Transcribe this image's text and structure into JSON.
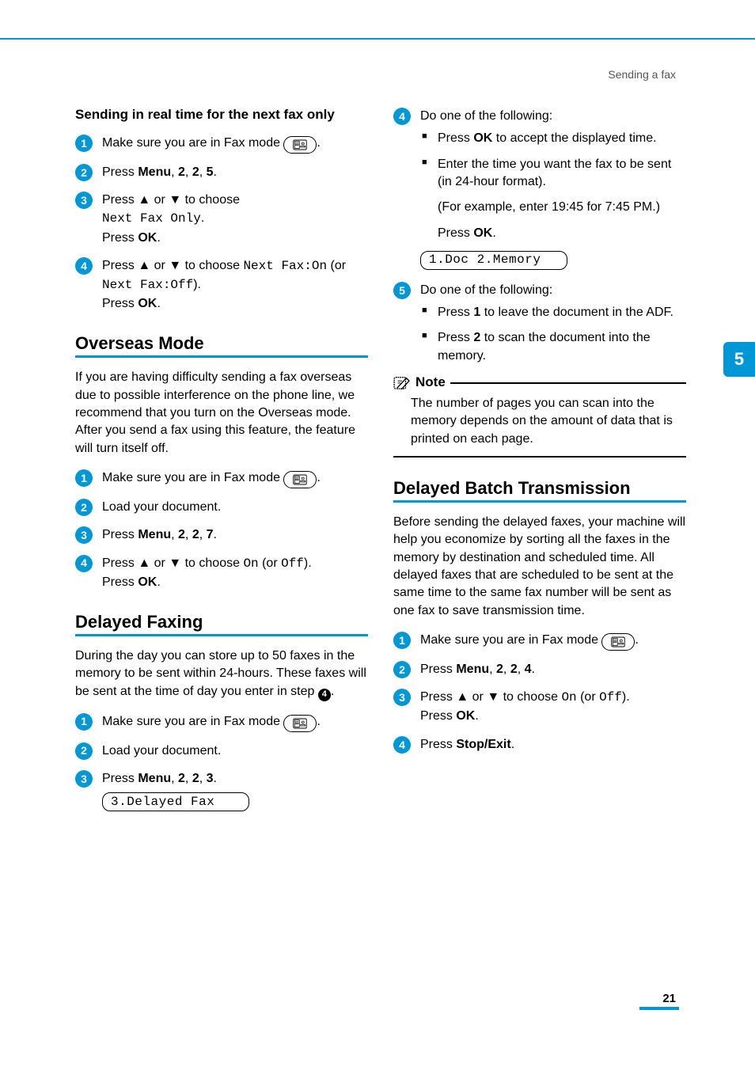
{
  "header": {
    "breadcrumb": "Sending a fax"
  },
  "tab": {
    "label": "5"
  },
  "footer": {
    "page": "21"
  },
  "left": {
    "realtime": {
      "title": "Sending in real time for the next fax only",
      "s1_a": "Make sure you are in Fax mode ",
      "s1_b": ".",
      "s2_a": "Press ",
      "s2_menu": "Menu",
      "s2_b": ", ",
      "s2_n1": "2",
      "s2_c": ", ",
      "s2_n2": "2",
      "s2_d": ", ",
      "s2_n3": "5",
      "s2_e": ".",
      "s3_a": "Press ",
      "s3_up": "▲",
      "s3_b": " or ",
      "s3_dn": "▼",
      "s3_c": " to choose ",
      "s3_code": "Next Fax Only",
      "s3_d": ".",
      "s3_e": "Press ",
      "s3_ok": "OK",
      "s3_f": ".",
      "s4_a": "Press ",
      "s4_up": "▲",
      "s4_b": " or ",
      "s4_dn": "▼",
      "s4_c": " to choose ",
      "s4_code1": "Next Fax:On",
      "s4_d": " (or ",
      "s4_code2": "Next Fax:Off",
      "s4_e": ").",
      "s4_f": "Press ",
      "s4_ok": "OK",
      "s4_g": "."
    },
    "overseas": {
      "title": "Overseas Mode",
      "intro": "If you are having difficulty sending a fax overseas due to possible interference on the phone line, we recommend that you turn on the Overseas mode. After you send a fax using this feature, the feature will turn itself off.",
      "s1_a": "Make sure you are in Fax mode ",
      "s1_b": ".",
      "s2": "Load your document.",
      "s3_a": "Press ",
      "s3_menu": "Menu",
      "s3_b": ", ",
      "s3_n1": "2",
      "s3_c": ", ",
      "s3_n2": "2",
      "s3_d": ", ",
      "s3_n3": "7",
      "s3_e": ".",
      "s4_a": "Press ",
      "s4_up": "▲",
      "s4_b": " or ",
      "s4_dn": "▼",
      "s4_c": " to choose ",
      "s4_code1": "On",
      "s4_d": " (or ",
      "s4_code2": "Off",
      "s4_e": ").",
      "s4_f": "Press ",
      "s4_ok": "OK",
      "s4_g": "."
    },
    "delayed": {
      "title": "Delayed Faxing",
      "intro_a": "During the day you can store up to 50 faxes in the memory to be sent within 24-hours. These faxes will be sent at the time of day you enter in step ",
      "intro_ref": "4",
      "intro_b": ".",
      "s1_a": "Make sure you are in Fax mode ",
      "s1_b": ".",
      "s2": "Load your document.",
      "s3_a": "Press ",
      "s3_menu": "Menu",
      "s3_b": ", ",
      "s3_n1": "2",
      "s3_c": ", ",
      "s3_n2": "2",
      "s3_d": ", ",
      "s3_n3": "3",
      "s3_e": ".",
      "lcd": "3.Delayed Fax"
    }
  },
  "right": {
    "s4_intro": "Do one of the following:",
    "s4_b1_a": "Press ",
    "s4_b1_ok": "OK",
    "s4_b1_b": " to accept the displayed time.",
    "s4_b2": "Enter the time you want the fax to be sent (in 24-hour format).",
    "s4_p1": "(For example, enter 19:45 for 7:45 PM.)",
    "s4_p2_a": "Press ",
    "s4_p2_ok": "OK",
    "s4_p2_b": ".",
    "lcd": "1.Doc 2.Memory",
    "s5_intro": "Do one of the following:",
    "s5_b1_a": "Press ",
    "s5_b1_n": "1",
    "s5_b1_b": " to leave the document in the ADF.",
    "s5_b2_a": "Press ",
    "s5_b2_n": "2",
    "s5_b2_b": " to scan the document into the memory.",
    "note": {
      "title": "Note",
      "body": "The number of pages you can scan into the memory depends on the amount of data that is printed on each page."
    },
    "batch": {
      "title": "Delayed Batch Transmission",
      "intro": "Before sending the delayed faxes, your machine will help you economize by sorting all the faxes in the memory by destination and scheduled time. All delayed faxes that are scheduled to be sent at the same time to the same fax number will be sent as one fax to save transmission time.",
      "s1_a": "Make sure you are in Fax mode ",
      "s1_b": ".",
      "s2_a": "Press ",
      "s2_menu": "Menu",
      "s2_b": ", ",
      "s2_n1": "2",
      "s2_c": ", ",
      "s2_n2": "2",
      "s2_d": ", ",
      "s2_n3": "4",
      "s2_e": ".",
      "s3_a": "Press ",
      "s3_up": "▲",
      "s3_b": " or ",
      "s3_dn": "▼",
      "s3_c": " to choose ",
      "s3_code1": "On",
      "s3_d": " (or ",
      "s3_code2": "Off",
      "s3_e": ").",
      "s3_f": "Press ",
      "s3_ok": "OK",
      "s3_g": ".",
      "s4_a": "Press ",
      "s4_btn": "Stop/Exit",
      "s4_b": "."
    }
  }
}
